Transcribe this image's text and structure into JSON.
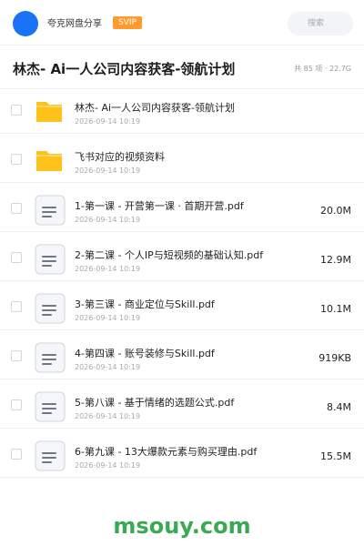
{
  "header": {
    "brand_name": "夸克网盘分享",
    "badge": "SVIP",
    "search_placeholder": "搜索"
  },
  "folder": {
    "title": "林杰- Ai一人公司内容获客-领航计划",
    "summary": "共 85 项 · 22.7G"
  },
  "files": [
    {
      "type": "folder",
      "name": "林杰- Ai一人公司内容获客-领航计划",
      "date": "2026-09-14 10:19",
      "size": ""
    },
    {
      "type": "folder",
      "name": "飞书对应的视频资料",
      "date": "2026-09-14 10:19",
      "size": ""
    },
    {
      "type": "document",
      "name": "1-第一课 - 开营第一课 · 首期开营.pdf",
      "date": "2026-09-14 10:19",
      "size": "20.0M"
    },
    {
      "type": "document",
      "name": "2-第二课 - 个人IP与短视频的基础认知.pdf",
      "date": "2026-09-14 10:19",
      "size": "12.9M"
    },
    {
      "type": "document",
      "name": "3-第三课 - 商业定位与Skill.pdf",
      "date": "2026-09-14 10:19",
      "size": "10.1M"
    },
    {
      "type": "document",
      "name": "4-第四课 - 账号装修与Skill.pdf",
      "date": "2026-09-14 10:19",
      "size": "919KB"
    },
    {
      "type": "document",
      "name": "5-第八课 - 基于情绪的选题公式.pdf",
      "date": "2026-09-14 10:19",
      "size": "8.4M"
    },
    {
      "type": "document",
      "name": "6-第九课 - 13大爆款元素与购买理由.pdf",
      "date": "2026-09-14 10:19",
      "size": "15.5M"
    }
  ],
  "watermark": "msouy.com",
  "colors": {
    "accent": "#1a73f5",
    "badge": "#ff9a2e",
    "folder": "#ffc21a",
    "watermark": "#3aaa52"
  }
}
